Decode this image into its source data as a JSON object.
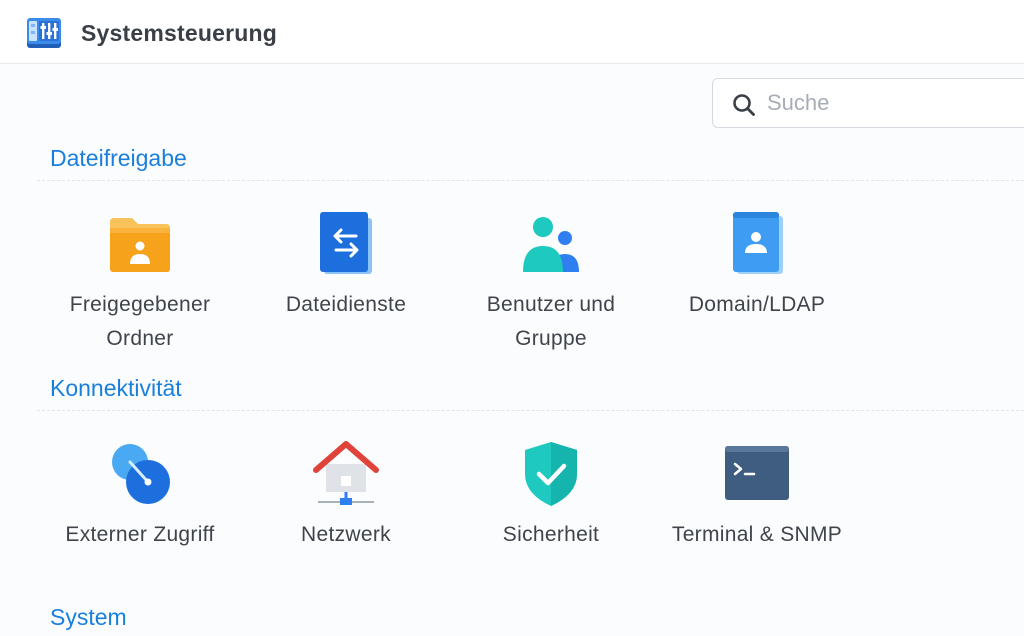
{
  "window": {
    "title": "Systemsteuerung",
    "app_icon": "control-panel-icon"
  },
  "search": {
    "placeholder": "Suche",
    "value": ""
  },
  "sections": [
    {
      "title": "Dateifreigabe",
      "items": [
        {
          "label": "Freigegebener Ordner",
          "icon": "shared-folder-icon"
        },
        {
          "label": "Dateidienste",
          "icon": "file-services-icon"
        },
        {
          "label": "Benutzer und Gruppe",
          "icon": "user-group-icon"
        },
        {
          "label": "Domain/LDAP",
          "icon": "domain-ldap-icon"
        }
      ]
    },
    {
      "title": "Konnektivität",
      "items": [
        {
          "label": "Externer Zugriff",
          "icon": "external-access-icon"
        },
        {
          "label": "Netzwerk",
          "icon": "network-icon"
        },
        {
          "label": "Sicherheit",
          "icon": "security-shield-icon"
        },
        {
          "label": "Terminal & SNMP",
          "icon": "terminal-icon"
        }
      ]
    },
    {
      "title": "System",
      "items": []
    }
  ],
  "colors": {
    "section_title": "#1a7fdc",
    "label_text": "#3f444c",
    "title_text": "#3a3f47"
  }
}
